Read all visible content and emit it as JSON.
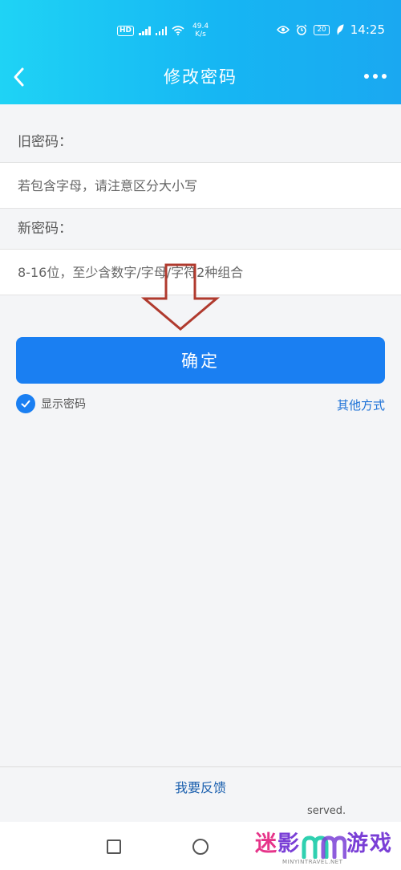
{
  "status_bar": {
    "network_speed_value": "49.4",
    "network_speed_unit": "K/s",
    "battery": "20",
    "time": "14:25",
    "icons": [
      "hd-icon",
      "signal-icon",
      "wifi-icon",
      "eye-icon",
      "alarm-icon",
      "battery-icon",
      "leaf-icon"
    ]
  },
  "header": {
    "title": "修改密码",
    "back_icon": "chevron-left-icon",
    "more_icon": "more-dots-icon"
  },
  "form": {
    "old_password_label": "旧密码：",
    "old_password_placeholder": "若包含字母，请注意区分大小写",
    "new_password_label": "新密码：",
    "new_password_placeholder": "8-16位，至少含数字/字母/字符2种组合"
  },
  "actions": {
    "confirm_label": "确定",
    "show_password_label": "显示密码",
    "show_password_checked": true,
    "other_methods_label": "其他方式"
  },
  "footer": {
    "feedback_label": "我要反馈",
    "served_text": "served."
  },
  "watermark": {
    "char1": "迷",
    "char2": "影",
    "char3": "游",
    "char4": "戏",
    "subtext": "MINYINTRAVEL.NET"
  },
  "colors": {
    "header_gradient_start": "#1fd3f5",
    "header_gradient_end": "#1aa8f1",
    "primary_button": "#1a7ff2",
    "link": "#1a70d6",
    "annotation_arrow": "#b03a2e"
  }
}
